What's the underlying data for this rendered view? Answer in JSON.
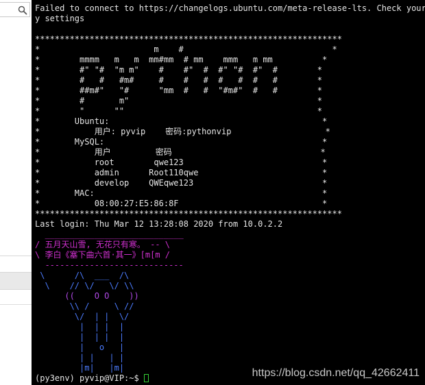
{
  "left_pane": {
    "search_icon": "search-icon"
  },
  "terminal": {
    "colors": {
      "background": "#000000",
      "text": "#e6e6e6",
      "poem": "#d030d0",
      "art": "#4c7cff",
      "cursor": "#35d035"
    },
    "lines": [
      {
        "text": "Failed to connect to https://changelogs.ubuntu.com/meta-release-lts. Check your Internet connection or prox",
        "color": ""
      },
      {
        "text": "y settings",
        "color": ""
      },
      {
        "text": "",
        "color": ""
      },
      {
        "text": "**************************************************************",
        "color": ""
      },
      {
        "text": "*                       m    #                              *",
        "color": ""
      },
      {
        "text": "*        mmmm   m   m  mm#mm  # mm    mmm   m mm          *",
        "color": ""
      },
      {
        "text": "*        #\" \"#  \"m m\"    #    #\"  #  #\" \"#  #\"  #        *",
        "color": ""
      },
      {
        "text": "*        #   #   #m#     #    #   #  #   #  #   #        *",
        "color": ""
      },
      {
        "text": "*        ##m#\"   \"#      \"mm  #   #  \"#m#\"  #   #        *",
        "color": ""
      },
      {
        "text": "*        #       m\"                                      *",
        "color": ""
      },
      {
        "text": "*        \"      \"\"                                       *",
        "color": ""
      },
      {
        "text": "*       Ubuntu:                                           *",
        "color": ""
      },
      {
        "text": "*           用户: pyvip    密码:pythonvip                   *",
        "color": ""
      },
      {
        "text": "*       MySQL:                                            *",
        "color": ""
      },
      {
        "text": "*           用户         密码                              *",
        "color": ""
      },
      {
        "text": "*           root        qwe123                            *",
        "color": ""
      },
      {
        "text": "*           admin      Root110qwe                         *",
        "color": ""
      },
      {
        "text": "*           develop    QWEqwe123                          *",
        "color": ""
      },
      {
        "text": "*       MAC:                                              *",
        "color": ""
      },
      {
        "text": "*           08:00:27:E5:86:8F                             *",
        "color": ""
      },
      {
        "text": "**************************************************************",
        "color": ""
      },
      {
        "text": "Last login: Thu Mar 12 13:28:08 2020 from 10.0.2.2",
        "color": ""
      },
      {
        "text": "  ____________________________",
        "color": "magenta"
      },
      {
        "text": "/ 五月天山雪, 无花只有寒。 -- \\",
        "color": "magenta"
      },
      {
        "text": "\\ 李白《塞下曲六首·其一》[m[m /",
        "color": "magenta"
      },
      {
        "text": "  ----------------------------",
        "color": "magenta"
      },
      {
        "text": " \\      /\\  ___  /\\",
        "color": "blue"
      },
      {
        "text": "  \\    // \\/   \\/ \\\\",
        "color": "blue"
      },
      {
        "text": "      ((    O O    ))",
        "color": "purple"
      },
      {
        "text": "       \\\\ /     \\ //",
        "color": "blue"
      },
      {
        "text": "        \\/  | |  \\/",
        "color": "blue"
      },
      {
        "text": "         |  | |  |",
        "color": "blue"
      },
      {
        "text": "         |  | |  |",
        "color": "blue"
      },
      {
        "text": "         |   o   |",
        "color": "blue"
      },
      {
        "text": "         | |   | |",
        "color": "blue"
      },
      {
        "text": "         |m|   |m|",
        "color": "blue"
      }
    ],
    "prompt": "(py3env) pyvip@VIP:~$ "
  },
  "watermark": "https://blog.csdn.net/qq_42662411"
}
